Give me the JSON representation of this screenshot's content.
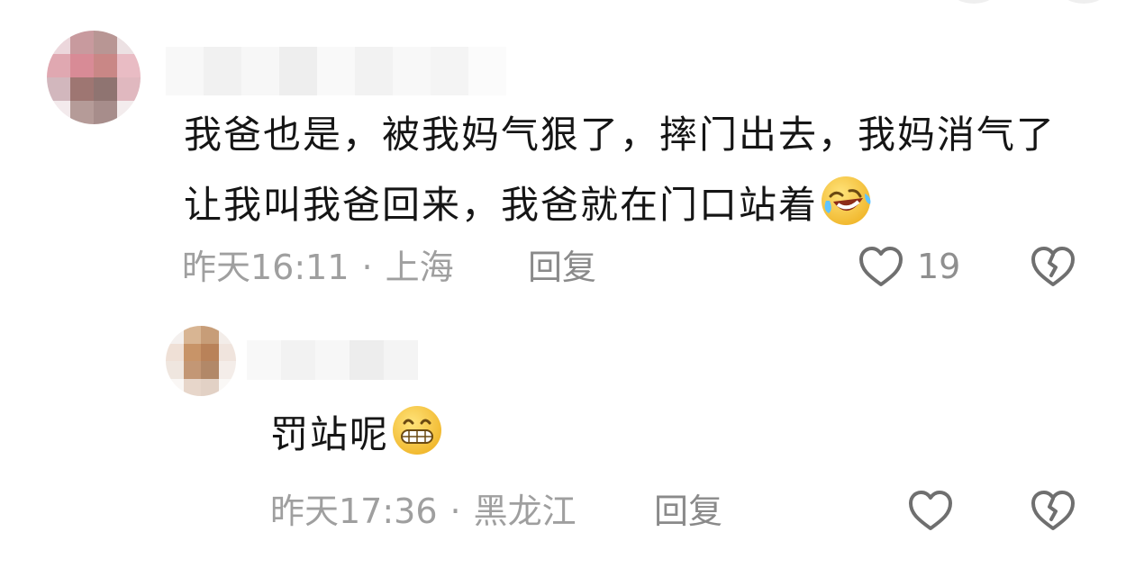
{
  "comments": [
    {
      "username": "",
      "text": "我爸也是，被我妈气狠了，摔门出去，我妈消气了让我叫我爸回来，我爸就在门口站着",
      "time": "昨天16:11",
      "separator": "·",
      "location": "上海",
      "reply_label": "回复",
      "like_count": "19",
      "emoji": "laughing-crying-emoji"
    },
    {
      "username": "",
      "text": "罚站呢",
      "time": "昨天17:36",
      "separator": "·",
      "location": "黑龙江",
      "reply_label": "回复",
      "like_count": "",
      "emoji": "grinning-emoji"
    }
  ],
  "colors": {
    "text_primary": "#151515",
    "text_meta": "#9f9f9f",
    "icon": "#6f6f6f",
    "emoji_yellow": "#ffd34d"
  },
  "icons": {
    "like": "heart-outline-icon",
    "dislike": "broken-heart-outline-icon"
  }
}
